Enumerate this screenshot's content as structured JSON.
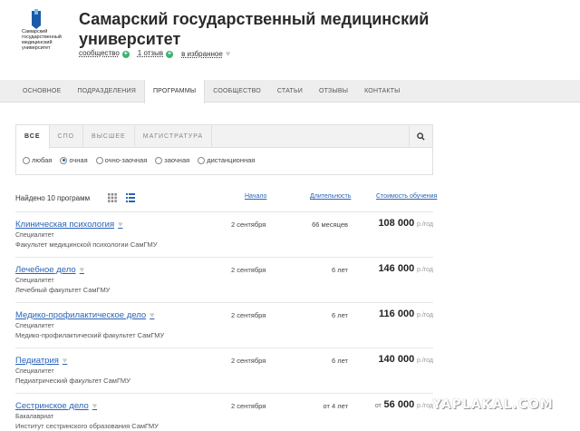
{
  "header": {
    "logo_text": "Самарский государственный медицинский университет",
    "title": "Самарский государственный медицинский университет",
    "community_link": "сообщество",
    "reviews_link": "1 отзыв",
    "favorites_link": "в избранное"
  },
  "nav": {
    "items": [
      "ОСНОВНОЕ",
      "ПОДРАЗДЕЛЕНИЯ",
      "ПРОГРАММЫ",
      "СООБЩЕСТВО",
      "СТАТЬИ",
      "ОТЗЫВЫ",
      "КОНТАКТЫ"
    ],
    "active": "ПРОГРАММЫ"
  },
  "filter": {
    "tabs": [
      "ВСЕ",
      "СПО",
      "ВЫСШЕЕ",
      "МАГИСТРАТУРА"
    ],
    "active_tab": "ВСЕ",
    "forms": [
      "любая",
      "очная",
      "очно-заочная",
      "заочная",
      "дистанционная"
    ],
    "selected_form": "очная"
  },
  "results": {
    "found": "Найдено 10 программ",
    "col_start": "Начало",
    "col_duration": "Длительность",
    "col_cost": "Стоимость обучения",
    "programs": [
      {
        "name": "Клиническая психология",
        "level": "Специалитет",
        "faculty": "Факультет медицинской психологии СамГМУ",
        "start": "2 сентября",
        "duration": "66 месяцев",
        "price_prefix": "",
        "price": "108 000",
        "unit": "р./год"
      },
      {
        "name": "Лечебное дело",
        "level": "Специалитет",
        "faculty": "Лечебный факультет СамГМУ",
        "start": "2 сентября",
        "duration": "6 лет",
        "price_prefix": "",
        "price": "146 000",
        "unit": "р./год"
      },
      {
        "name": "Медико-профилактическое дело",
        "level": "Специалитет",
        "faculty": "Медико-профилактический факультет СамГМУ",
        "start": "2 сентября",
        "duration": "6 лет",
        "price_prefix": "",
        "price": "116 000",
        "unit": "р./год"
      },
      {
        "name": "Педиатрия",
        "level": "Специалитет",
        "faculty": "Педиатрический факультет СамГМУ",
        "start": "2 сентября",
        "duration": "6 лет",
        "price_prefix": "",
        "price": "140 000",
        "unit": "р./год"
      },
      {
        "name": "Сестринское дело",
        "level": "Бакалавриат",
        "faculty": "Институт сестринского образования СамГМУ",
        "start": "2 сентября",
        "duration": "от 4 лет",
        "price_prefix": "от",
        "price": "56 000",
        "unit": "р./год"
      }
    ]
  },
  "watermark": "YAPLAKAL.COM",
  "colors": {
    "link": "#2a63b6",
    "accent_green": "#3cb371",
    "nav_bg": "#eeeeee"
  }
}
